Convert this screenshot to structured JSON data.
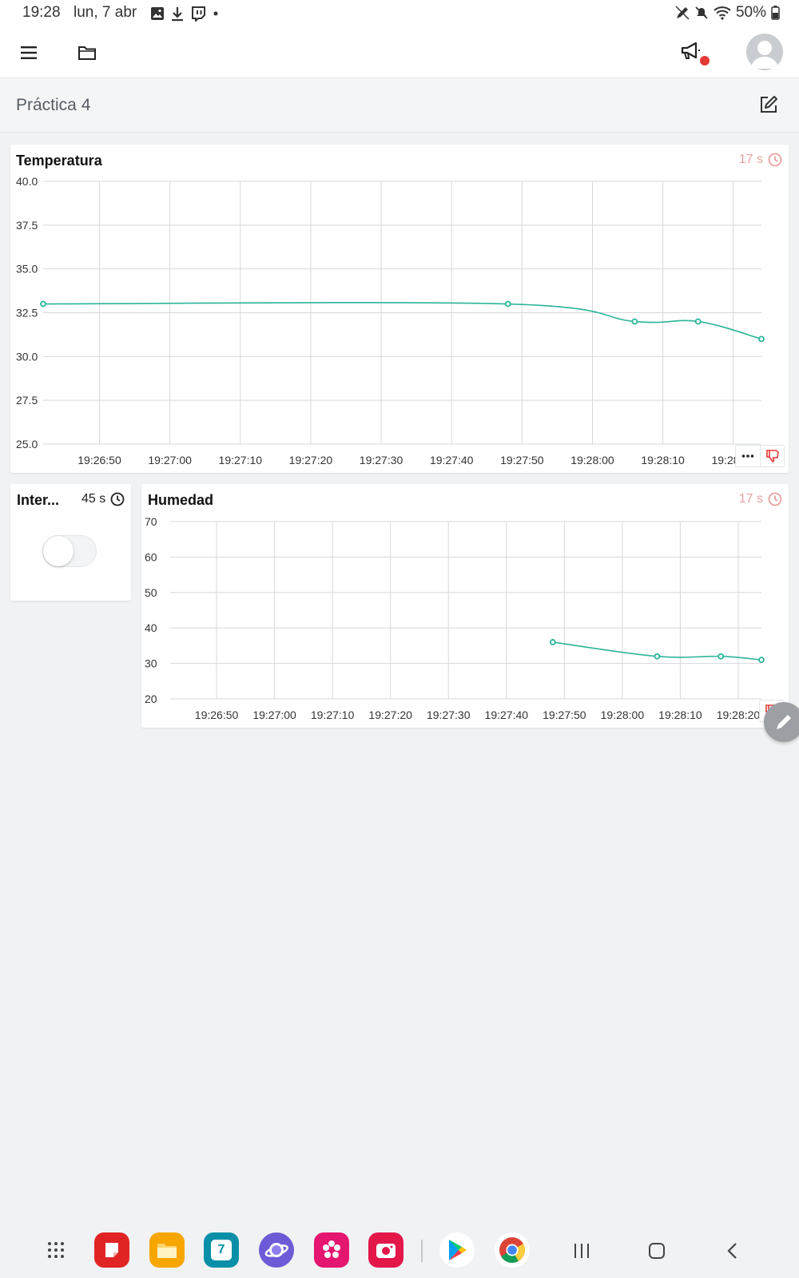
{
  "status_bar": {
    "time": "19:28",
    "date": "lun, 7 abr",
    "battery": "50%",
    "left_icons": [
      "gallery-icon",
      "download-icon",
      "twitch-icon",
      "dot-icon"
    ],
    "right_icons": [
      "edit-pen-icon",
      "mute-icon",
      "wifi-icon",
      "battery-icon"
    ]
  },
  "header": {
    "menu_icon": "hamburger-icon",
    "folder_icon": "folder-icon",
    "announce_icon": "megaphone-icon",
    "notification_color": "#e53935",
    "avatar_icon": "user-avatar-icon"
  },
  "page": {
    "title": "Práctica 4",
    "edit_icon": "edit-icon"
  },
  "widgets": {
    "temperature": {
      "title": "Temperatura",
      "age": "17 s",
      "clock_icon": "clock-icon",
      "more_icon": "more-icon",
      "dislike_icon": "thumbs-down-icon",
      "line_color": "#2bb598",
      "age_color": "#e8a1a1"
    },
    "switch": {
      "title": "Inter...",
      "age": "45 s",
      "clock_icon": "clock-icon",
      "state": "off"
    },
    "humidity": {
      "title": "Humedad",
      "age": "17 s",
      "clock_icon": "clock-icon",
      "dislike_icon": "thumbs-down-icon",
      "line_color": "#2bb598",
      "age_color": "#e8a1a1"
    }
  },
  "chart_data": [
    {
      "type": "line",
      "title": "Temperatura",
      "x_ticks": [
        "19:26:50",
        "19:27:00",
        "19:27:10",
        "19:27:20",
        "19:27:30",
        "19:27:40",
        "19:27:50",
        "19:28:00",
        "19:28:10",
        "19:28:20"
      ],
      "y_ticks": [
        "40.0",
        "37.5",
        "35.0",
        "32.5",
        "30.0",
        "27.5",
        "25.0"
      ],
      "ylim": [
        25,
        40
      ],
      "xlim": [
        "19:26:42",
        "19:28:24"
      ],
      "grid": true,
      "series": [
        {
          "x": [
            "19:26:42",
            "19:27:48",
            "19:28:06",
            "19:28:15",
            "19:28:24"
          ],
          "values": [
            33.0,
            33.0,
            32.0,
            32.0,
            31.0
          ]
        }
      ]
    },
    {
      "type": "line",
      "title": "Humedad",
      "x_ticks": [
        "19:26:50",
        "19:27:00",
        "19:27:10",
        "19:27:20",
        "19:27:30",
        "19:27:40",
        "19:27:50",
        "19:28:00",
        "19:28:10",
        "19:28:20"
      ],
      "y_ticks": [
        "70",
        "60",
        "50",
        "40",
        "30",
        "20"
      ],
      "ylim": [
        20,
        70
      ],
      "xlim": [
        "19:26:42",
        "19:28:24"
      ],
      "grid": true,
      "series": [
        {
          "x": [
            "19:27:48",
            "19:28:06",
            "19:28:17",
            "19:28:24"
          ],
          "values": [
            36,
            32,
            32,
            31
          ]
        }
      ]
    }
  ],
  "dock": {
    "apps": [
      "apps-grid-icon",
      "notes-app-icon",
      "files-app-icon",
      "calendar-app-icon",
      "internet-app-icon",
      "blossom-app-icon",
      "camera-app-icon",
      "play-store-icon",
      "chrome-icon"
    ],
    "calendar_day": "7",
    "nav": [
      "recents-icon",
      "home-icon",
      "back-icon"
    ]
  }
}
